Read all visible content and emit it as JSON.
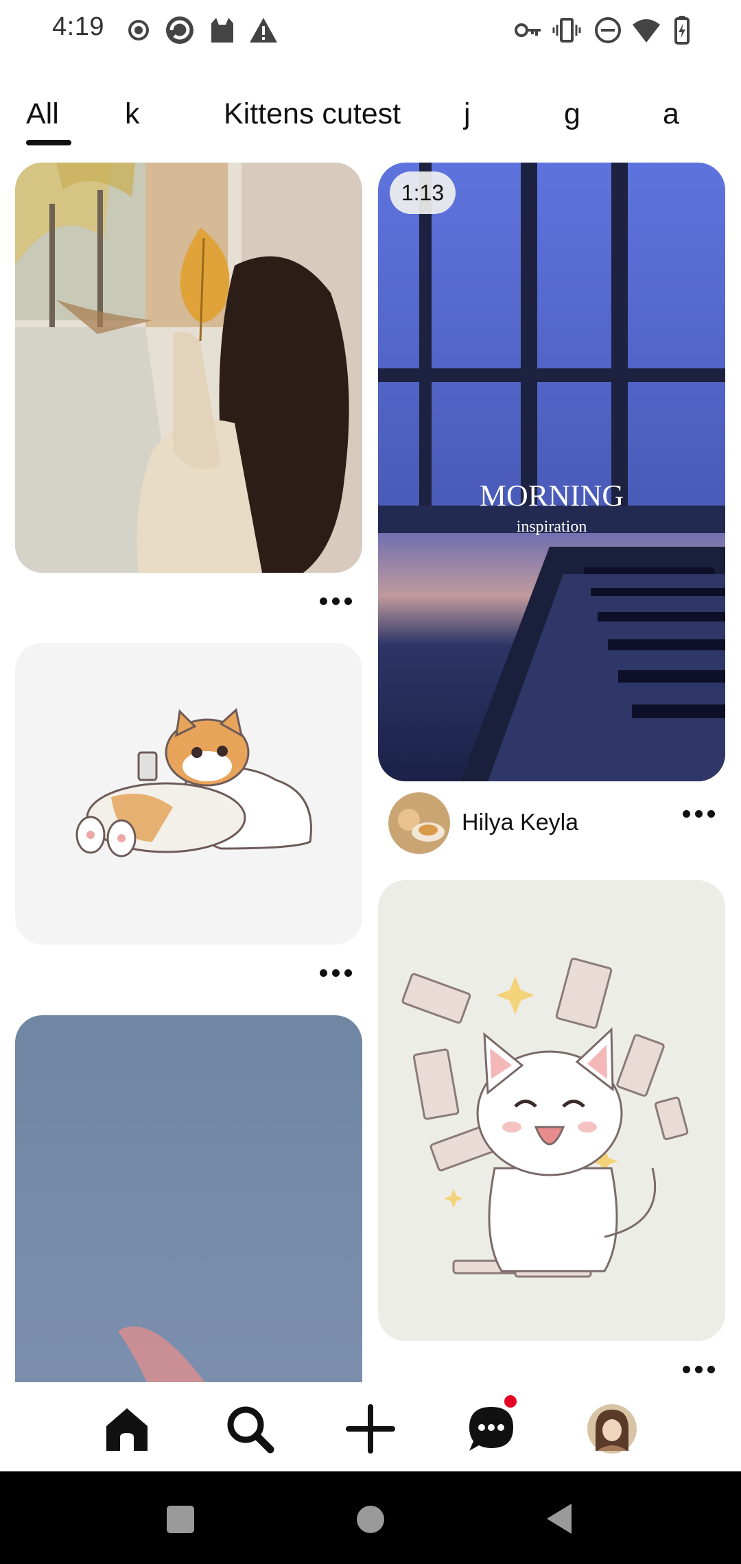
{
  "status_bar": {
    "time": "4:19",
    "left_icons": [
      "record-icon",
      "browser-icon",
      "cat-app-icon",
      "warning-icon"
    ],
    "right_icons": [
      "key-icon",
      "vibrate-icon",
      "do-not-disturb-icon",
      "wifi-icon",
      "battery-charging-icon"
    ]
  },
  "tabs": [
    {
      "label": "All",
      "selected": true
    },
    {
      "label": "k"
    },
    {
      "label": "Kittens cutest"
    },
    {
      "label": "j"
    },
    {
      "label": "g"
    },
    {
      "label": "a"
    }
  ],
  "feed": {
    "pins": [
      {
        "id": "girl-leaf",
        "description_icon": "image"
      },
      {
        "id": "morning-video",
        "duration": "1:13",
        "overlay_title": "MORNING",
        "overlay_subtitle": "inspiration",
        "author": "Hilya Keyla"
      },
      {
        "id": "cat-sofa"
      },
      {
        "id": "cat-money"
      },
      {
        "id": "sky"
      }
    ]
  },
  "bottom_nav": {
    "items": [
      "home-icon",
      "search-icon",
      "create-icon",
      "messages-icon",
      "profile-avatar"
    ],
    "active": "home-icon",
    "notification_color": "#e60023"
  },
  "system_nav": [
    "recents-button",
    "home-button",
    "back-button"
  ]
}
